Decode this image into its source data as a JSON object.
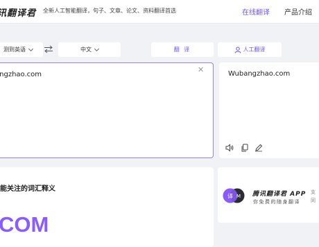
{
  "header": {
    "logo": "讯翻译君",
    "slogan": "全新人工智能翻译，句子、文章、论文、资料翻译首选",
    "nav": [
      {
        "label": "在线翻译",
        "active": true
      },
      {
        "label": "产品介绍",
        "active": false
      }
    ]
  },
  "toolbar": {
    "source_language": "测到英语",
    "target_language": "中文",
    "translate_button": "翻 译",
    "human_translate_button": "人工翻译"
  },
  "input": {
    "value": "angzhao.com"
  },
  "output": {
    "value": "Wubangzhao.com"
  },
  "dictionary": {
    "title": "能关注的词汇释义",
    "word": "COM"
  },
  "app_promo": {
    "title": "腾讯翻译君 APP",
    "subtitle": "你免费的随身翻译",
    "side_text_1": "支",
    "side_text_2": "同"
  },
  "colors": {
    "accent": "#7455ff",
    "word": "#8a5cff",
    "background": "#f1f2f6"
  }
}
